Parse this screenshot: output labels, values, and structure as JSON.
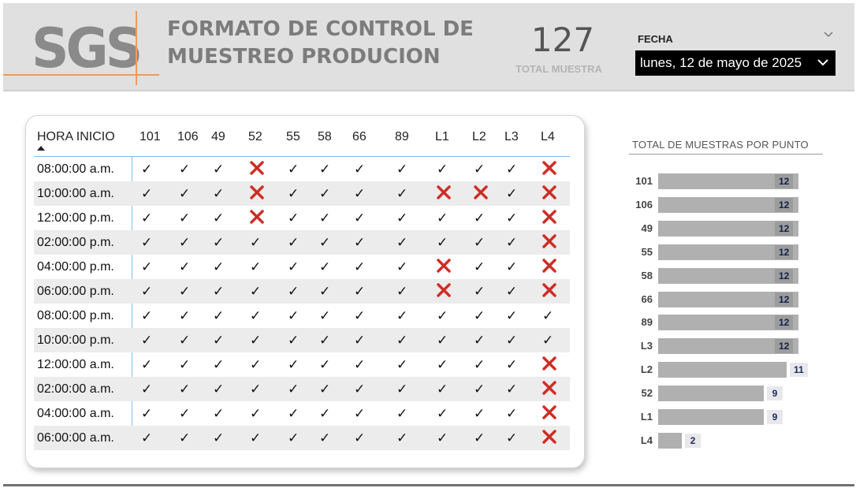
{
  "header": {
    "logo_text": "SGS",
    "title_line1": "FORMATO DE CONTROL DE",
    "title_line2": "MUESTREO PRODUCION",
    "kpi_value": "127",
    "kpi_label": "TOTAL MUESTRA",
    "fecha_label": "FECHA",
    "fecha_value": "lunes, 12 de mayo de 2025"
  },
  "table": {
    "first_col_header": "HORA INICIO",
    "columns": [
      "101",
      "106",
      "49",
      "52",
      "55",
      "58",
      "66",
      "89",
      "L1",
      "L2",
      "L3",
      "L4"
    ],
    "rows": [
      {
        "time": "08:00:00 a.m.",
        "marks": [
          "ok",
          "ok",
          "ok",
          "x",
          "ok",
          "ok",
          "ok",
          "ok",
          "ok",
          "ok",
          "ok",
          "x"
        ]
      },
      {
        "time": "10:00:00 a.m.",
        "marks": [
          "ok",
          "ok",
          "ok",
          "x",
          "ok",
          "ok",
          "ok",
          "ok",
          "x",
          "x",
          "ok",
          "x"
        ]
      },
      {
        "time": "12:00:00 p.m.",
        "marks": [
          "ok",
          "ok",
          "ok",
          "x",
          "ok",
          "ok",
          "ok",
          "ok",
          "ok",
          "ok",
          "ok",
          "x"
        ]
      },
      {
        "time": "02:00:00 p.m.",
        "marks": [
          "ok",
          "ok",
          "ok",
          "ok",
          "ok",
          "ok",
          "ok",
          "ok",
          "ok",
          "ok",
          "ok",
          "x"
        ]
      },
      {
        "time": "04:00:00 p.m.",
        "marks": [
          "ok",
          "ok",
          "ok",
          "ok",
          "ok",
          "ok",
          "ok",
          "ok",
          "x",
          "ok",
          "ok",
          "x"
        ]
      },
      {
        "time": "06:00:00 p.m.",
        "marks": [
          "ok",
          "ok",
          "ok",
          "ok",
          "ok",
          "ok",
          "ok",
          "ok",
          "x",
          "ok",
          "ok",
          "x"
        ]
      },
      {
        "time": "08:00:00 p.m.",
        "marks": [
          "ok",
          "ok",
          "ok",
          "ok",
          "ok",
          "ok",
          "ok",
          "ok",
          "ok",
          "ok",
          "ok",
          "ok"
        ]
      },
      {
        "time": "10:00:00 p.m.",
        "marks": [
          "ok",
          "ok",
          "ok",
          "ok",
          "ok",
          "ok",
          "ok",
          "ok",
          "ok",
          "ok",
          "ok",
          "ok"
        ]
      },
      {
        "time": "12:00:00 a.m.",
        "marks": [
          "ok",
          "ok",
          "ok",
          "ok",
          "ok",
          "ok",
          "ok",
          "ok",
          "ok",
          "ok",
          "ok",
          "x"
        ]
      },
      {
        "time": "02:00:00 a.m.",
        "marks": [
          "ok",
          "ok",
          "ok",
          "ok",
          "ok",
          "ok",
          "ok",
          "ok",
          "ok",
          "ok",
          "ok",
          "x"
        ]
      },
      {
        "time": "04:00:00 a.m.",
        "marks": [
          "ok",
          "ok",
          "ok",
          "ok",
          "ok",
          "ok",
          "ok",
          "ok",
          "ok",
          "ok",
          "ok",
          "x"
        ]
      },
      {
        "time": "06:00:00 a.m.",
        "marks": [
          "ok",
          "ok",
          "ok",
          "ok",
          "ok",
          "ok",
          "ok",
          "ok",
          "ok",
          "ok",
          "ok",
          "x"
        ]
      }
    ],
    "check_glyph": "✓",
    "cross_color": "#d9342b"
  },
  "chart_data": {
    "type": "bar",
    "title": "TOTAL DE MUESTRAS POR PUNTO",
    "orientation": "horizontal",
    "categories": [
      "101",
      "106",
      "49",
      "55",
      "58",
      "66",
      "89",
      "L3",
      "L2",
      "52",
      "L1",
      "L4"
    ],
    "values": [
      12,
      12,
      12,
      12,
      12,
      12,
      12,
      12,
      11,
      9,
      9,
      2
    ],
    "xlim": [
      0,
      12
    ],
    "bar_color": "#b0b0b0"
  }
}
